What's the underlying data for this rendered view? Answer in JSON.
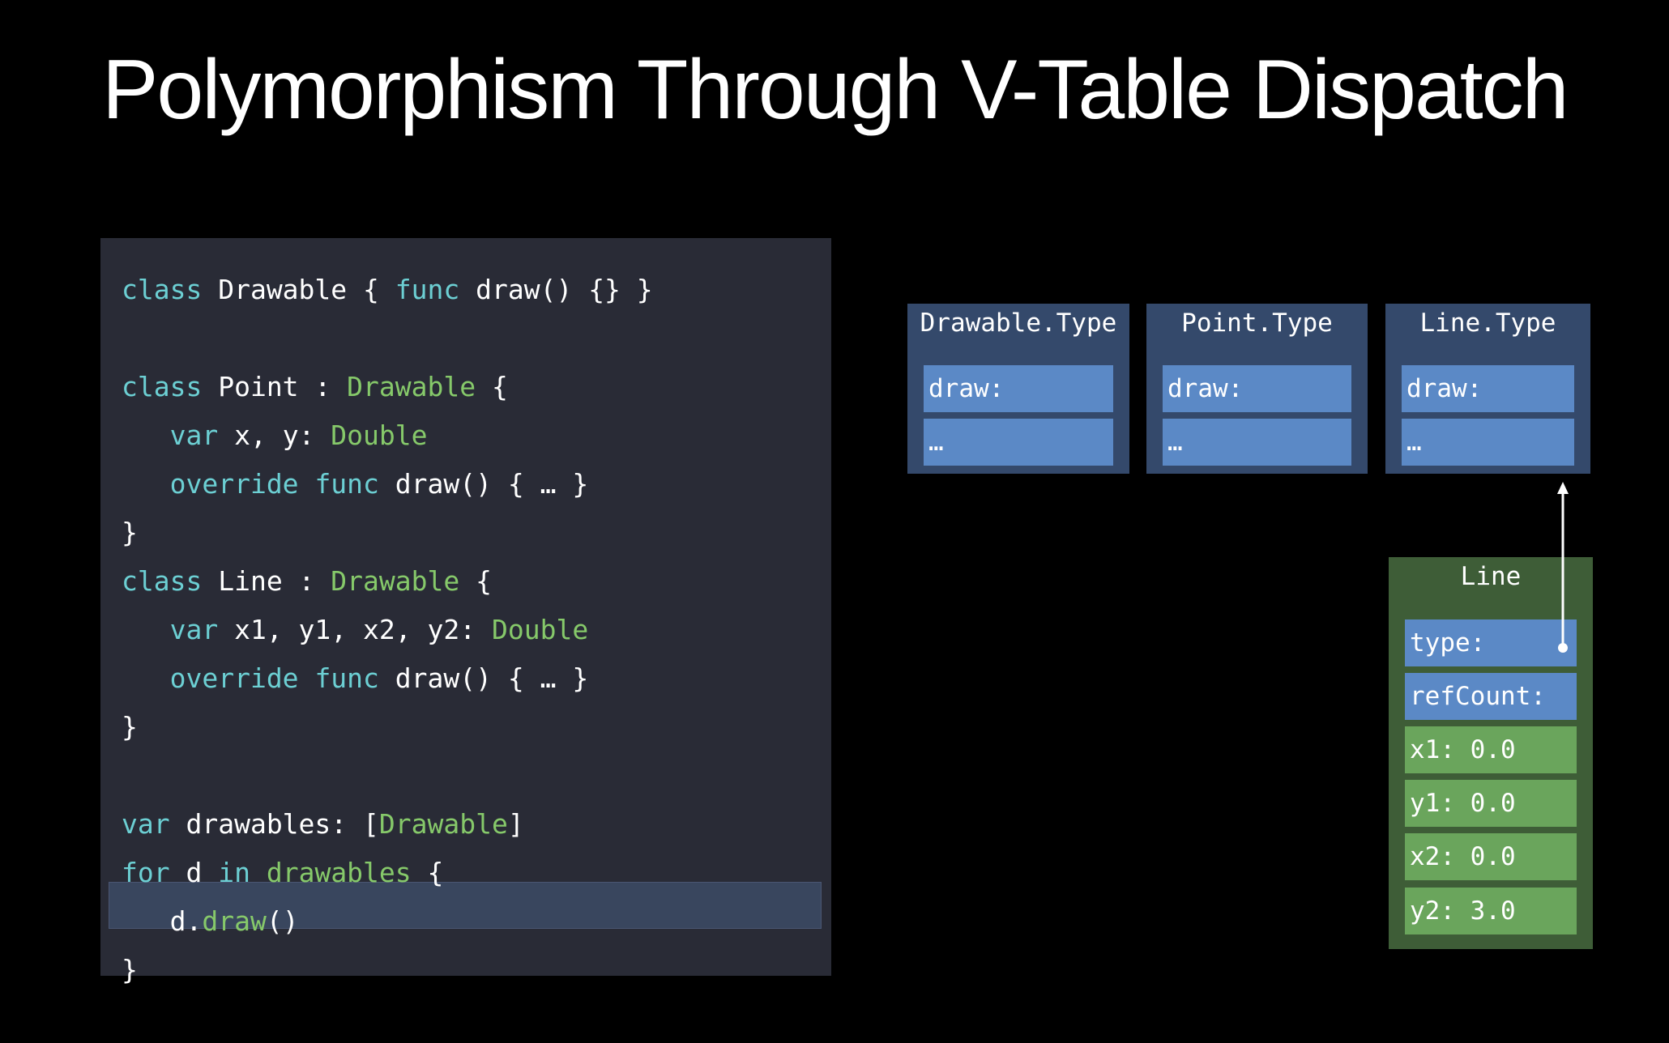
{
  "title": "Polymorphism Through V-Table Dispatch",
  "code": {
    "line1": {
      "kw1": "class",
      "t1": " Drawable { ",
      "kw2": "func",
      "t2": " draw() {} }"
    },
    "line3": {
      "kw1": "class",
      "t1": " Point : ",
      "ty1": "Drawable",
      "t2": " {"
    },
    "line4": {
      "indent": "   ",
      "kw1": "var",
      "t1": " x, y: ",
      "ty1": "Double"
    },
    "line5": {
      "indent": "   ",
      "kw1": "override",
      "sp": " ",
      "kw2": "func",
      "t1": " draw() { … }"
    },
    "line6": {
      "t1": "}"
    },
    "line7": {
      "kw1": "class",
      "t1": " Line : ",
      "ty1": "Drawable",
      "t2": " {"
    },
    "line8": {
      "indent": "   ",
      "kw1": "var",
      "t1": " x1, y1, x2, y2: ",
      "ty1": "Double"
    },
    "line9": {
      "indent": "   ",
      "kw1": "override",
      "sp": " ",
      "kw2": "func",
      "t1": " draw() { … }"
    },
    "line10": {
      "t1": "}"
    },
    "line12": {
      "kw1": "var",
      "t1": " drawables: [",
      "ty1": "Drawable",
      "t2": "]"
    },
    "line13": {
      "kw1": "for",
      "t1": " d ",
      "kw2": "in",
      "sp": " ",
      "ty1": "drawables",
      "t2": " {"
    },
    "line14": {
      "indent": "   ",
      "t1": "d.",
      "ty1": "draw",
      "t2": "()"
    },
    "line15": {
      "t1": "}"
    }
  },
  "vtables": [
    {
      "name": "Drawable.Type",
      "slots": [
        "draw:",
        "…"
      ]
    },
    {
      "name": "Point.Type",
      "slots": [
        "draw:",
        "…"
      ]
    },
    {
      "name": "Line.Type",
      "slots": [
        "draw:",
        "…"
      ]
    }
  ],
  "line_object": {
    "name": "Line",
    "fields": [
      "type:",
      "refCount:",
      "x1: 0.0",
      "y1: 0.0",
      "x2: 0.0",
      "y2: 3.0"
    ]
  },
  "colors": {
    "background": "#000000",
    "code_panel": "#292b36",
    "keyword": "#6ccfd3",
    "type_name": "#86c96a",
    "vtable_bg": "#34496b",
    "slot_blue": "#5b89c6",
    "object_bg": "#3e5d37",
    "field_green": "#6aa55c"
  }
}
